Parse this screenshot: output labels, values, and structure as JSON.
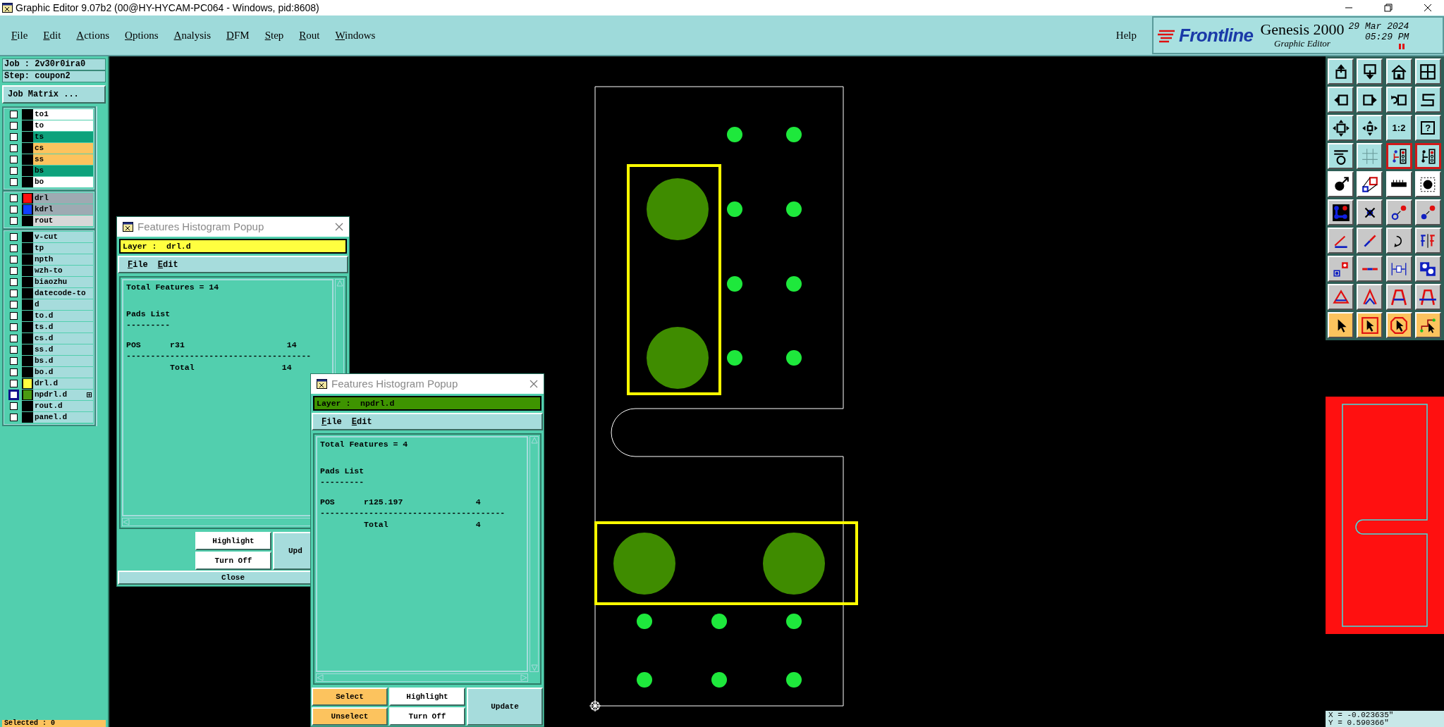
{
  "window": {
    "title": "Graphic Editor 9.07b2 (00@HY-HYCAM-PC064 - Windows, pid:8608)"
  },
  "menu": [
    "File",
    "Edit",
    "Actions",
    "Options",
    "Analysis",
    "DFM",
    "Step",
    "Rout",
    "Windows"
  ],
  "help": "Help",
  "brand": {
    "logo": "Frontline",
    "product": "Genesis 2000",
    "subtitle": "Graphic Editor",
    "date": "29 Mar 2024",
    "time": "05:29 PM"
  },
  "job": "Job : 2v30r0ira0",
  "step": "Step: coupon2",
  "job_matrix": "Job Matrix ...",
  "layer_groups": [
    {
      "items": [
        {
          "name": "to1",
          "kind": "silk",
          "checked": false,
          "work_layer": false
        },
        {
          "name": "to",
          "kind": "silk",
          "checked": false,
          "work_layer": false
        },
        {
          "name": "ts",
          "kind": "mask",
          "checked": false,
          "work_layer": false
        },
        {
          "name": "cs",
          "kind": "signal",
          "checked": false,
          "work_layer": false
        },
        {
          "name": "ss",
          "kind": "signal",
          "checked": false,
          "work_layer": false
        },
        {
          "name": "bs",
          "kind": "mask",
          "checked": false,
          "work_layer": false
        },
        {
          "name": "bo",
          "kind": "silk",
          "checked": false,
          "work_layer": false
        }
      ]
    },
    {
      "items": [
        {
          "name": "drl",
          "kind": "drill",
          "color": "#ff1010",
          "checked": false,
          "work_layer": false
        },
        {
          "name": "kdrl",
          "kind": "drill",
          "color": "#1040ff",
          "checked": false,
          "work_layer": false
        },
        {
          "name": "rout",
          "kind": "rout",
          "checked": false,
          "work_layer": false
        }
      ]
    },
    {
      "items": [
        {
          "name": "v-cut",
          "kind": "misc",
          "checked": false,
          "work_layer": false
        },
        {
          "name": "tp",
          "kind": "misc",
          "checked": false,
          "work_layer": false
        },
        {
          "name": "npth",
          "kind": "misc",
          "checked": false,
          "work_layer": false
        },
        {
          "name": "wzh-to",
          "kind": "misc",
          "checked": false,
          "work_layer": false
        },
        {
          "name": "biaozhu",
          "kind": "misc",
          "checked": false,
          "work_layer": false
        },
        {
          "name": "datecode-to",
          "kind": "misc",
          "checked": false,
          "work_layer": false
        },
        {
          "name": "d",
          "kind": "misc",
          "checked": false,
          "work_layer": false
        },
        {
          "name": "to.d",
          "kind": "misc",
          "checked": false,
          "work_layer": false
        },
        {
          "name": "ts.d",
          "kind": "misc",
          "checked": false,
          "work_layer": false
        },
        {
          "name": "cs.d",
          "kind": "misc",
          "checked": false,
          "work_layer": false
        },
        {
          "name": "ss.d",
          "kind": "misc",
          "checked": false,
          "work_layer": false
        },
        {
          "name": "bs.d",
          "kind": "misc",
          "checked": false,
          "work_layer": false
        },
        {
          "name": "bo.d",
          "kind": "misc",
          "checked": false,
          "work_layer": false
        },
        {
          "name": "drl.d",
          "kind": "misc",
          "color": "#ffff40",
          "checked": false,
          "work_layer": false
        },
        {
          "name": "npdrl.d",
          "kind": "misc",
          "color": "#4a9a10",
          "checked": false,
          "work_layer": true
        },
        {
          "name": "rout.d",
          "kind": "misc",
          "checked": false,
          "work_layer": false
        },
        {
          "name": "panel.d",
          "kind": "misc",
          "checked": false,
          "work_layer": false
        }
      ]
    }
  ],
  "selected_count": "Selected : 0",
  "popups": [
    {
      "title": "Features Histogram Popup",
      "layer": "Layer :  drl.d",
      "color": "#ffff40",
      "menu": [
        "File",
        "Edit"
      ],
      "total": "Total Features = 14",
      "section": "Pads List",
      "underline": "---------",
      "rows": [
        "POS      r31                     14"
      ],
      "rule": "--------------------------------------",
      "sum": "         Total                  14",
      "buttons": [
        {
          "label": "Highlight",
          "kind": "display"
        },
        {
          "label": "Turn Off",
          "kind": "display"
        },
        {
          "label": "Upd",
          "kind": "update"
        },
        {
          "label": "Close",
          "kind": "close"
        }
      ]
    },
    {
      "title": "Features Histogram Popup",
      "layer": "Layer :  npdrl.d",
      "color": "#3e9400",
      "menu": [
        "File",
        "Edit"
      ],
      "total": "Total Features = 4",
      "section": "Pads List",
      "underline": "---------",
      "rows": [
        "POS      r125.197               4"
      ],
      "rule": "--------------------------------------",
      "sum": "         Total                  4",
      "buttons": [
        {
          "label": "Select",
          "kind": "select"
        },
        {
          "label": "Highlight",
          "kind": "display"
        },
        {
          "label": "Update",
          "kind": "update"
        },
        {
          "label": "Unselect",
          "kind": "select"
        },
        {
          "label": "Turn Off",
          "kind": "display"
        }
      ]
    }
  ],
  "toolbar": [
    {
      "pressed": false
    },
    {
      "pressed": false
    },
    {
      "pressed": false
    },
    {
      "pressed": false
    },
    {
      "pressed": false
    },
    {
      "pressed": false
    },
    {
      "pressed": false
    },
    {
      "pressed": false
    },
    {
      "pressed": false
    },
    {
      "pressed": false
    },
    {
      "pressed": false,
      "label": "1:2"
    },
    {
      "pressed": false,
      "label": "?"
    },
    {
      "pressed": false
    },
    {
      "pressed": false
    },
    {
      "pressed": true
    },
    {
      "pressed": true
    },
    {
      "pressed": false
    },
    {
      "pressed": false
    },
    {
      "pressed": false
    },
    {
      "pressed": false
    },
    {
      "pressed": false
    },
    {
      "pressed": false
    },
    {
      "pressed": false
    },
    {
      "pressed": false
    },
    {
      "pressed": false
    },
    {
      "pressed": false
    },
    {
      "pressed": false
    },
    {
      "pressed": false
    },
    {
      "pressed": false
    },
    {
      "pressed": false
    },
    {
      "pressed": false
    },
    {
      "pressed": false
    },
    {
      "pressed": false
    },
    {
      "pressed": false
    },
    {
      "pressed": false
    },
    {
      "pressed": false
    },
    {
      "pressed": false
    },
    {
      "pressed": false
    },
    {
      "pressed": false
    },
    {
      "pressed": false
    }
  ],
  "coords": {
    "x": "X = -0.023635\"",
    "y": "Y = 0.590366\""
  }
}
